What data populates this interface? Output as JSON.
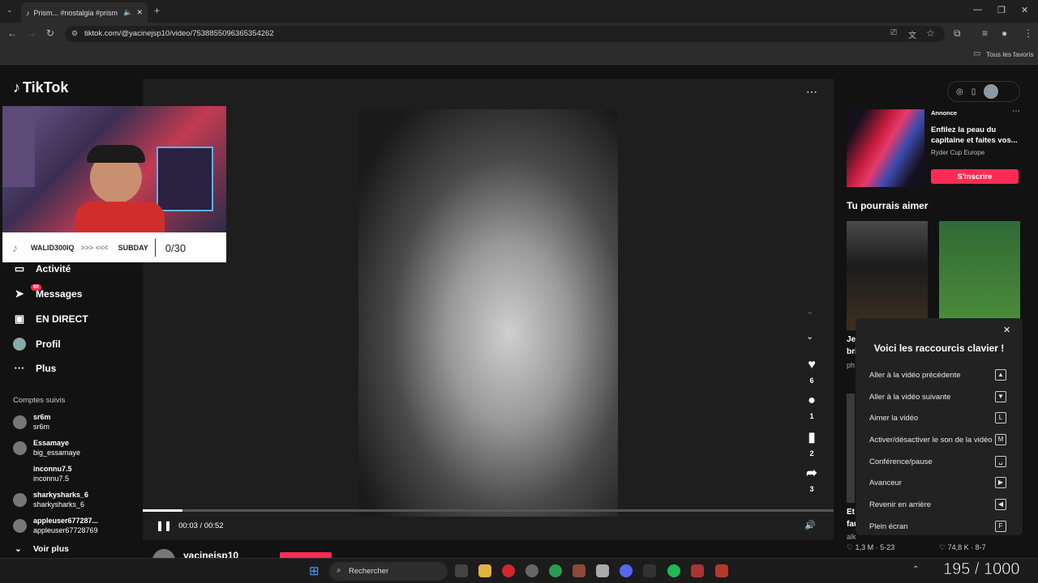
{
  "browser": {
    "tab_title": "Prism... #nostalgia #prism",
    "url": "tiktok.com/@yacinejsp10/video/7538855096365354262",
    "bookmarks_label": "Tous les favoris"
  },
  "logo": "TikTok",
  "webcam": {
    "name": "WALID300IQ",
    "arrows": ">>> <<<",
    "tag": "SUBDAY",
    "count": "0/30"
  },
  "nav": [
    {
      "label": "Activité",
      "icon": "activity-icon"
    },
    {
      "label": "Messages",
      "icon": "messages-icon",
      "badge": "60"
    },
    {
      "label": "EN DIRECT",
      "icon": "live-icon"
    },
    {
      "label": "Profil",
      "icon": "profile-icon"
    },
    {
      "label": "Plus",
      "icon": "more-icon"
    }
  ],
  "following": {
    "title": "Comptes suivis",
    "accounts": [
      {
        "name": "sr6m",
        "handle": "sr6m"
      },
      {
        "name": "Essamaye",
        "handle": "big_essamaye"
      },
      {
        "name": "inconnu7.5",
        "handle": "inconnu7.5"
      },
      {
        "name": "sharkysharks_6",
        "handle": "sharkysharks_6"
      },
      {
        "name": "appleuser677287...",
        "handle": "appleuser67728769"
      }
    ],
    "see_more": "Voir plus"
  },
  "video": {
    "time": "00:03 / 00:52",
    "progress": 0.058,
    "author": "yacinejsp10",
    "likes": "6",
    "comments": "1",
    "saves": "2",
    "shares": "3"
  },
  "ad": {
    "label": "Annonce",
    "title": "Enfilez la peau du capitaine et faites vos...",
    "sponsor": "Ryder Cup Europe",
    "button": "S'inscrire"
  },
  "suggestions": {
    "title": "Tu pourrais aimer",
    "stats_left": "♡ 1,3 M · 5-23",
    "stats_right": "♡ 74,8 K · 8-7",
    "left_caption_1": "Je",
    "left_caption_2": "bri",
    "left_caption_3": "ph",
    "left_caption_4": "Et",
    "left_caption_5": "fau",
    "left_caption_6": "alk"
  },
  "shortcuts": {
    "title": "Voici les raccourcis clavier !",
    "items": [
      {
        "label": "Aller à la vidéo précédente",
        "key": "▲"
      },
      {
        "label": "Aller à la vidéo suivante",
        "key": "▼"
      },
      {
        "label": "Aimer la vidéo",
        "key": "L"
      },
      {
        "label": "Activer/désactiver le son de la vidéo",
        "key": "M"
      },
      {
        "label": "Conférence/pause",
        "key": "␣"
      },
      {
        "label": "Avanceur",
        "key": "▶"
      },
      {
        "label": "Revenir en arrière",
        "key": "◀"
      },
      {
        "label": "Plein écran",
        "key": "F"
      }
    ]
  },
  "taskbar": {
    "search": "Rechercher",
    "counter": "195 / 1000"
  }
}
